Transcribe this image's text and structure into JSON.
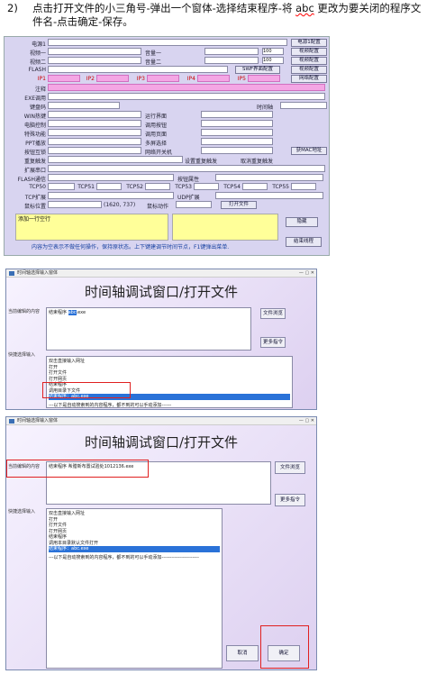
{
  "instruction": {
    "number": "2)",
    "line1_a": "点击打开文件的小三角号-弹出一个窗体-选择结束程序-将 ",
    "line1_abc": "abc",
    "line1_b": " 更改为要关闭的程序文",
    "line2": "件名-点击确定-保存。"
  },
  "config_form": {
    "rows": [
      {
        "label": "电源1",
        "btn": "电源1配置"
      },
      {
        "label": "视频一",
        "mid_label": "音量一",
        "mid_value": "100",
        "btn": "视频配置"
      },
      {
        "label": "视频二",
        "mid_label": "音量二",
        "mid_value": "100",
        "btn": "视频配置"
      },
      {
        "label": "FLASH",
        "mid_btn": "SWF界面配置",
        "btn": "视频配置"
      },
      {
        "label": "IP1",
        "ips": [
          "IP2",
          "IP3",
          "IP4",
          "IP5"
        ],
        "btn": "网络配置"
      },
      {
        "label": "注释"
      },
      {
        "label": "EXE调用"
      },
      {
        "label": "键盘码",
        "right_label": "时间轴"
      },
      {
        "label": "WIN热键",
        "mid_label": "运行界面"
      },
      {
        "label": "电脑控制",
        "mid_label": "调用按钮"
      },
      {
        "label": "特殊功能",
        "mid_label": "调用页面"
      },
      {
        "label": "PPT播放",
        "mid_label": "多屏选择"
      },
      {
        "label": "按钮互锁",
        "mid_label": "网络开关机",
        "btn": "获MAC地址"
      },
      {
        "label": "重复触发",
        "radio1": "设置重复触发",
        "radio2": "取消重复触发"
      },
      {
        "label": "扩展串口"
      },
      {
        "label": "FLASH通信",
        "mid_label": "按钮属性"
      },
      {
        "label": "TCP50",
        "tcp": [
          "TCP51",
          "TCP52",
          "TCP53",
          "TCP54",
          "TCP55"
        ]
      },
      {
        "label": "TCP扩展",
        "mid_label": "UDP扩展"
      },
      {
        "label": "鼠标位置",
        "coords": "(1620, 737)",
        "mid_label": "鼠标动作",
        "btn2": "打开文件"
      }
    ],
    "add_row": "添加一行空行",
    "hide_btn": "隐藏",
    "end_program_btn": "结束线程",
    "hint": "内容为空表示不做任何操作，保持原状态。上下键建调节时间节点，F1键弹出菜单."
  },
  "dialog1": {
    "window_title": "时间轴选择输入窗体",
    "title": "时间轴调试窗口/打开文件",
    "current_label": "当前编辑的内容",
    "current_text_a": "结束程序 ",
    "current_text_sel": "abc",
    "current_text_b": ".exe",
    "browse_btn": "文件浏览",
    "more_btn": "更多指令",
    "quick_label": "快捷选择输入",
    "options": [
      "双击直接输入网址",
      "打开",
      "打开文件",
      "打开网页",
      "结束程序",
      "调用目录下文件",
      "结束程序：abc.exe"
    ],
    "footer_line": "---以下是自动搜索到的内容程序，都不到的可以手动添加------"
  },
  "dialog2": {
    "window_title": "时间轴选择输入窗体",
    "title": "时间轴调试窗口/打开文件",
    "current_label": "当前编辑的内容",
    "current_text": "结束程序 希腊新布置试验处1012136.exe",
    "browse_btn": "文件浏览",
    "more_btn": "更多指令",
    "quick_label": "快捷选择输入",
    "options": [
      "双击直接输入网址",
      "打开",
      "打开文件",
      "打开网页",
      "结束程序",
      "调用本目录默认文件打开",
      "结束程序：abc.exe"
    ],
    "footer_line": "---以下是自动搜索到的内容程序，都不到的可以手动添加-----------------------",
    "cancel_btn": "取消",
    "ok_btn": "确定"
  }
}
